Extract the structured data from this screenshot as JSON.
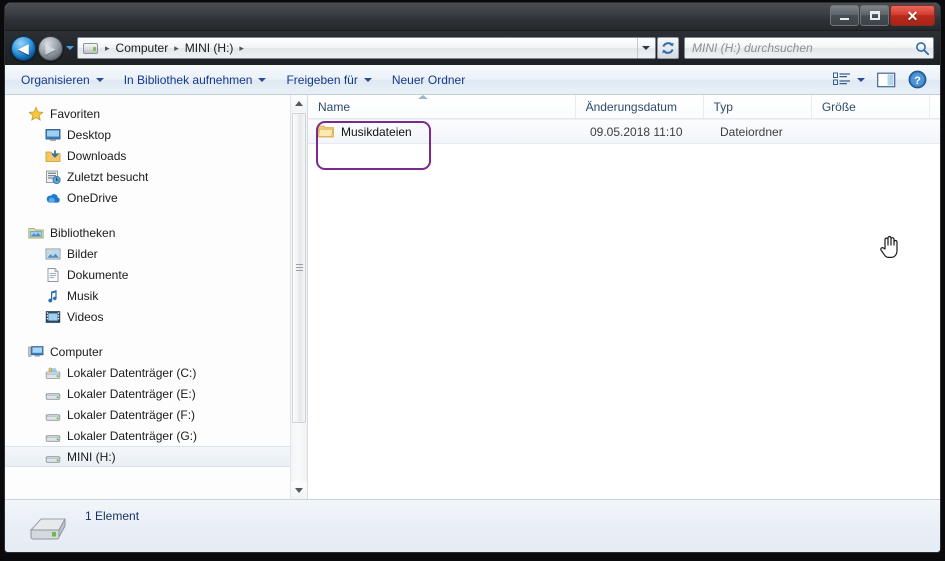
{
  "window": {
    "controls": {
      "minimize_label": "−",
      "maximize_label": "",
      "close_label": "✕"
    }
  },
  "addressbar": {
    "back_tooltip": "Zurück",
    "forward_tooltip": "Vorwärts",
    "breadcrumb": [
      "Computer",
      "MINI (H:)"
    ],
    "separator": "▸",
    "refresh_icon": "refresh-icon"
  },
  "search": {
    "placeholder": "MINI (H:) durchsuchen",
    "value": "",
    "icon": "search-icon"
  },
  "toolbar": {
    "items": [
      {
        "label": "Organisieren",
        "caret": true
      },
      {
        "label": "In Bibliothek aufnehmen",
        "caret": true
      },
      {
        "label": "Freigeben für",
        "caret": true
      },
      {
        "label": "Neuer Ordner",
        "caret": false
      }
    ],
    "view_icon": "view-layout-icon",
    "view_caret_icon": "chevron-down-icon",
    "preview_pane_icon": "preview-pane-icon",
    "help_icon": "help-icon"
  },
  "navpane": {
    "groups": [
      {
        "header": {
          "label": "Favoriten",
          "icon": "star-icon"
        },
        "items": [
          {
            "label": "Desktop",
            "icon": "desktop-icon"
          },
          {
            "label": "Downloads",
            "icon": "downloads-icon"
          },
          {
            "label": "Zuletzt besucht",
            "icon": "recent-places-icon"
          },
          {
            "label": "OneDrive",
            "icon": "onedrive-icon"
          }
        ]
      },
      {
        "header": {
          "label": "Bibliotheken",
          "icon": "libraries-icon"
        },
        "items": [
          {
            "label": "Bilder",
            "icon": "pictures-icon"
          },
          {
            "label": "Dokumente",
            "icon": "documents-icon"
          },
          {
            "label": "Musik",
            "icon": "music-icon"
          },
          {
            "label": "Videos",
            "icon": "videos-icon"
          }
        ]
      },
      {
        "header": {
          "label": "Computer",
          "icon": "computer-icon"
        },
        "items": [
          {
            "label": "Lokaler Datenträger (C:)",
            "icon": "system-drive-icon",
            "selected": false
          },
          {
            "label": "Lokaler Datenträger (E:)",
            "icon": "drive-icon",
            "selected": false
          },
          {
            "label": "Lokaler Datenträger (F:)",
            "icon": "drive-icon",
            "selected": false
          },
          {
            "label": "Lokaler Datenträger (G:)",
            "icon": "drive-icon",
            "selected": false
          },
          {
            "label": "MINI (H:)",
            "icon": "drive-icon",
            "selected": true
          }
        ]
      }
    ]
  },
  "filelist": {
    "columns": [
      {
        "key": "name",
        "label": "Name",
        "sorted": "asc"
      },
      {
        "key": "date",
        "label": "Änderungsdatum"
      },
      {
        "key": "type",
        "label": "Typ"
      },
      {
        "key": "size",
        "label": "Größe"
      }
    ],
    "rows": [
      {
        "name": "Musikdateien",
        "date": "09.05.2018 11:10",
        "type": "Dateiordner",
        "size": "",
        "icon": "folder-icon",
        "annotated": true
      }
    ]
  },
  "statusbar": {
    "icon": "removable-drive-icon",
    "text": "1 Element"
  },
  "colors": {
    "annotation": "#7a2a8c",
    "toolbar_text": "#15398a",
    "column_header_text": "#2e4a6b",
    "status_text": "#16325c",
    "close_button": "#d33f30"
  }
}
